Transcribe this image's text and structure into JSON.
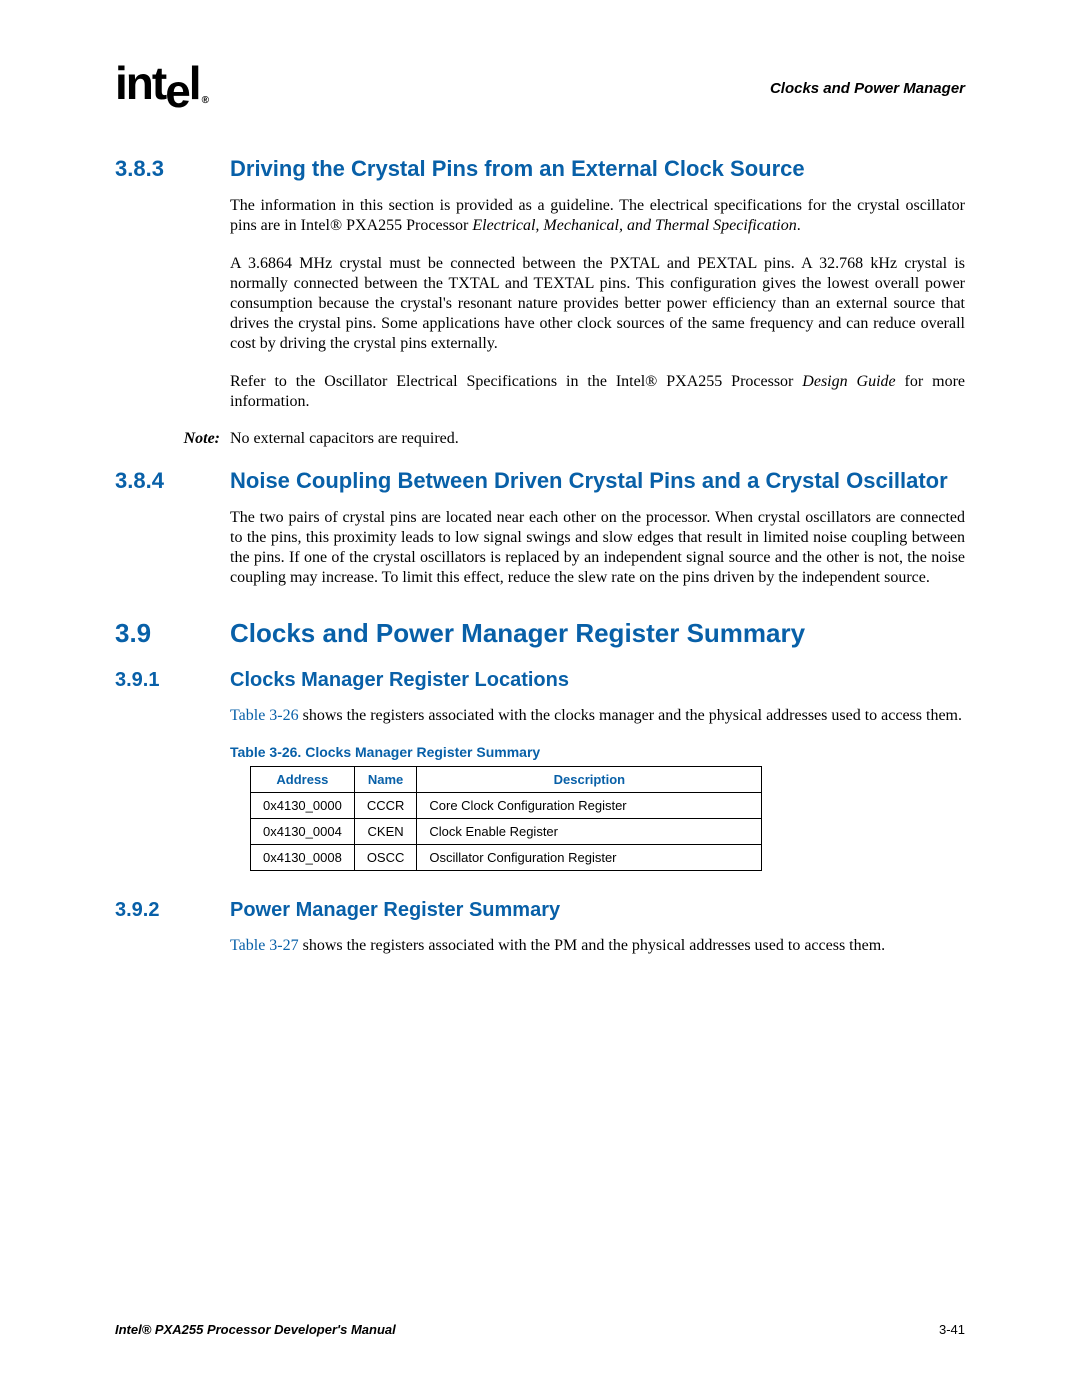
{
  "header": {
    "logo_text": "intel",
    "logo_mark": "®",
    "chapter": "Clocks and Power Manager"
  },
  "s383": {
    "num": "3.8.3",
    "title": "Driving the Crystal Pins from an External Clock Source",
    "p1_a": "The information in this section is provided as a guideline. The electrical specifications for the crystal oscillator pins are in Intel® PXA255 Processor ",
    "p1_i": "Electrical, Mechanical, and Thermal Specification",
    "p1_b": ".",
    "p2": "A 3.6864 MHz crystal must be connected between the PXTAL and PEXTAL pins. A 32.768 kHz crystal is normally connected between the TXTAL and TEXTAL pins. This configuration gives the lowest overall power consumption because the crystal's resonant nature provides better power efficiency than an external source that drives the crystal pins. Some applications have other clock sources of the same frequency and can reduce overall cost by driving the crystal pins externally.",
    "p3_a": "Refer to the Oscillator Electrical Specifications in the Intel® PXA255 Processor ",
    "p3_i": "Design Guide",
    "p3_b": " for more information.",
    "note_label": "Note:",
    "note_text": "No external capacitors are required."
  },
  "s384": {
    "num": "3.8.4",
    "title": "Noise Coupling Between Driven Crystal Pins and a Crystal Oscillator",
    "p1": "The two pairs of crystal pins are located near each other on the processor. When crystal oscillators are connected to the pins, this proximity leads to low signal swings and slow edges that result in limited noise coupling between the pins. If one of the crystal oscillators is replaced by an independent signal source and the other is not, the noise coupling may increase. To limit this effect, reduce the slew rate on the pins driven by the independent source."
  },
  "s39": {
    "num": "3.9",
    "title": "Clocks and Power Manager Register Summary"
  },
  "s391": {
    "num": "3.9.1",
    "title": "Clocks Manager Register Locations",
    "p1_link": "Table 3-26",
    "p1_rest": " shows the registers associated with the clocks manager and the physical addresses used to access them.",
    "table_caption": "Table 3-26. Clocks Manager Register Summary",
    "th": {
      "address": "Address",
      "name": "Name",
      "desc": "Description"
    },
    "rows": [
      {
        "address": "0x4130_0000",
        "name": "CCCR",
        "desc": "Core Clock Configuration Register"
      },
      {
        "address": "0x4130_0004",
        "name": "CKEN",
        "desc": "Clock Enable Register"
      },
      {
        "address": "0x4130_0008",
        "name": "OSCC",
        "desc": "Oscillator Configuration Register"
      }
    ]
  },
  "s392": {
    "num": "3.9.2",
    "title": "Power Manager Register Summary",
    "p1_link": "Table 3-27",
    "p1_rest": " shows the registers associated with the PM and the physical addresses used to access them."
  },
  "footer": {
    "title": "Intel® PXA255 Processor Developer's Manual",
    "page": "3-41"
  }
}
